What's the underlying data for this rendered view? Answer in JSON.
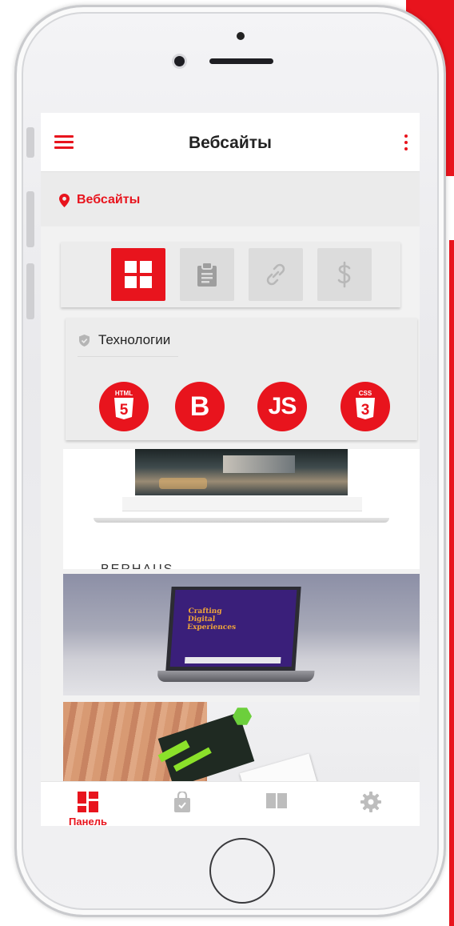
{
  "app": {
    "title": "Вебсайты"
  },
  "breadcrumb": {
    "label": "Вебсайты"
  },
  "tabs": [
    {
      "icon": "grid-icon",
      "active": true
    },
    {
      "icon": "clipboard-icon",
      "active": false
    },
    {
      "icon": "link-icon",
      "active": false
    },
    {
      "icon": "dollar-icon",
      "active": false
    }
  ],
  "technologies": {
    "title": "Технологии",
    "items": [
      {
        "icon": "html5-icon",
        "badge": "HTML",
        "glyph": "5"
      },
      {
        "icon": "bootstrap-icon",
        "glyph": "B"
      },
      {
        "icon": "javascript-icon",
        "glyph": "JS"
      },
      {
        "icon": "css3-icon",
        "badge": "CSS",
        "glyph": "3"
      }
    ]
  },
  "projects": [
    {
      "caption": "BERHAUS"
    },
    {
      "laptop_heading": "Crafting Digital Experiences"
    },
    {}
  ],
  "bottom_nav": [
    {
      "label": "Панель",
      "icon": "dashboard-icon",
      "active": true
    },
    {
      "label": "",
      "icon": "shopping-bag-icon",
      "active": false
    },
    {
      "label": "",
      "icon": "book-icon",
      "active": false
    },
    {
      "label": "",
      "icon": "gear-icon",
      "active": false
    }
  ],
  "colors": {
    "accent": "#e8141d",
    "inactive": "#bdbdbd"
  }
}
